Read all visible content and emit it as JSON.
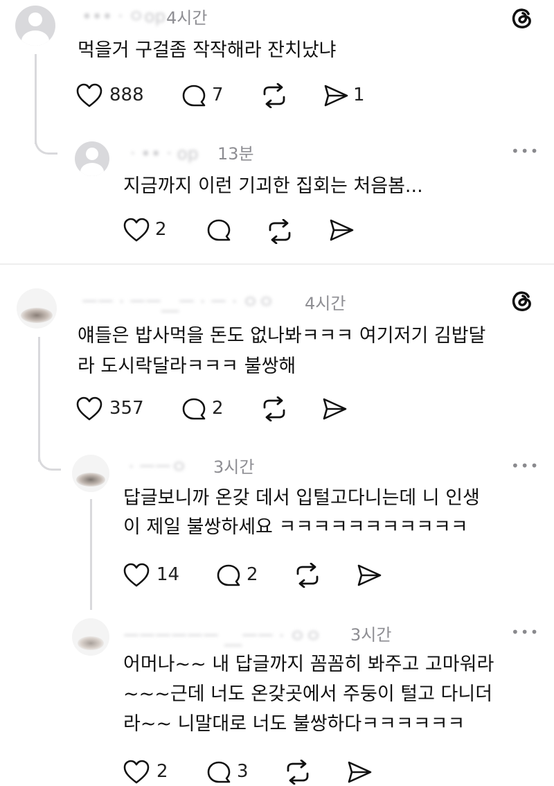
{
  "threads": [
    {
      "time": "4시간",
      "text": [
        "먹을거 구걸좀 작작해라 잔치났냐"
      ],
      "likes": "888",
      "replies": "7",
      "shares": "1",
      "reply": {
        "time": "13분",
        "text": [
          "지금까지 이런 기괴한 집회는 처음봄..."
        ],
        "likes": "2"
      }
    },
    {
      "time": "4시간",
      "text": [
        "얘들은 밥사먹을 돈도 없나봐ㅋㅋㅋ 여기저기 김밥달",
        "라 도시락달라ㅋㅋㅋ 불쌍해"
      ],
      "likes": "357",
      "replies": "2",
      "reply": {
        "time": "3시간",
        "text": [
          "답글보니까 온갖 데서 입털고다니는데 니 인생",
          "이 제일 불쌍하세요 ㅋㅋㅋㅋㅋㅋㅋㅋㅋㅋㅋ"
        ],
        "likes": "14",
        "replies": "2"
      },
      "reply2": {
        "time": "3시간",
        "text": [
          "어머나~~ 내 답글까지 꼼꼼히 봐주고 고마워라",
          "~~~근데 너도 온갖곳에서 주둥이 털고 다니더",
          "라~~ 니말대로 너도 불쌍하다ㅋㅋㅋㅋㅋㅋ"
        ],
        "likes": "2",
        "replies": "3"
      }
    }
  ],
  "more_label": "•••",
  "icons": {
    "like": "heart-icon",
    "reply": "comment-icon",
    "repost": "repost-icon",
    "share": "send-icon",
    "brand": "threads-logo-icon"
  }
}
